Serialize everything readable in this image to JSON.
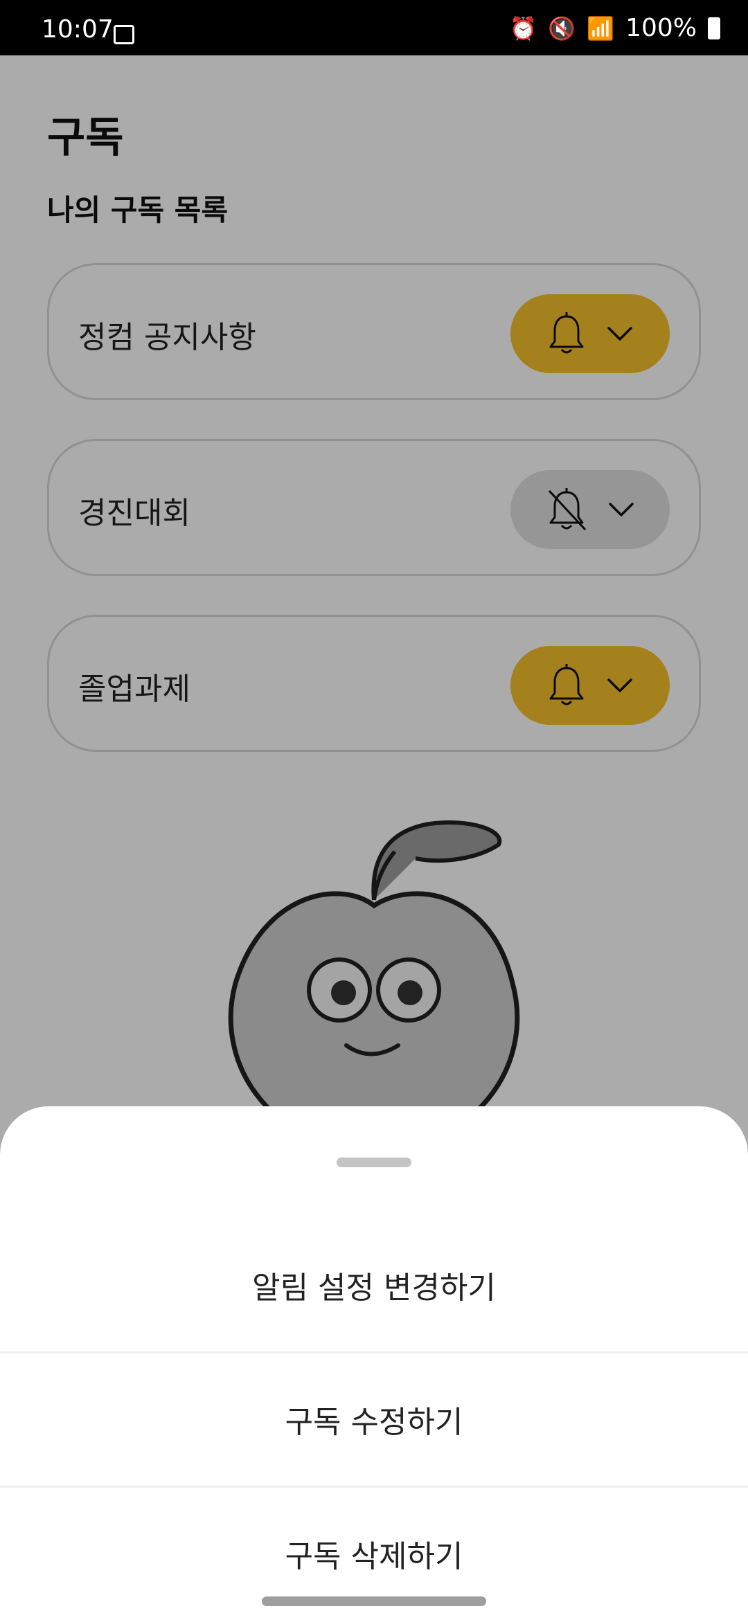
{
  "status_bar": {
    "time": "10:07",
    "battery_text": "100%",
    "icons": [
      "gallery-icon",
      "alarm-icon",
      "mute-icon",
      "wifi-icon",
      "signal-icon",
      "battery-icon"
    ]
  },
  "page": {
    "title": "구독",
    "section_title": "나의 구독 목록"
  },
  "subscriptions": [
    {
      "name": "정컴 공지사항",
      "notification": "on"
    },
    {
      "name": "경진대회",
      "notification": "off"
    },
    {
      "name": "졸업과제",
      "notification": "on"
    }
  ],
  "bottom_sheet": {
    "options": [
      {
        "label": "알림 설정 변경하기"
      },
      {
        "label": "구독 수정하기"
      },
      {
        "label": "구독 삭제하기"
      }
    ]
  },
  "colors": {
    "accent": "#f5c02a",
    "toggle_off": "#e0e0e0",
    "overlay": "rgba(0,0,0,0.33)"
  }
}
